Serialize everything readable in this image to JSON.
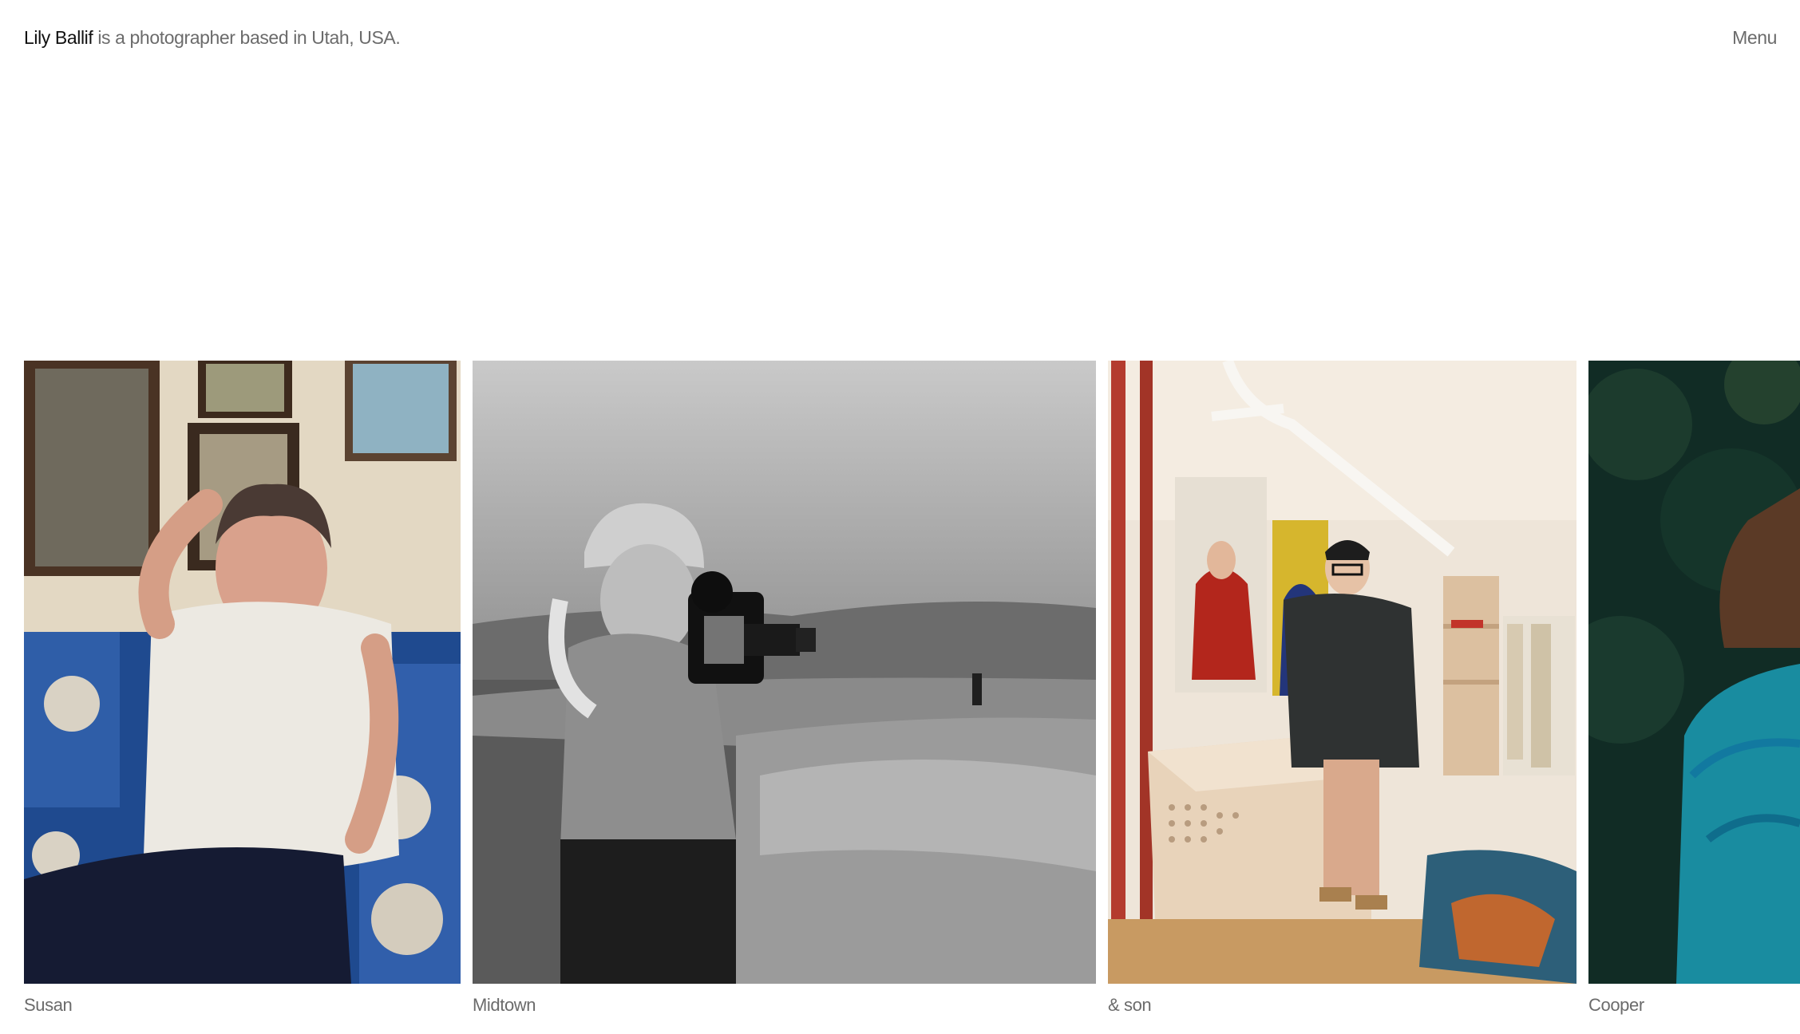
{
  "header": {
    "name": "Lily Ballif",
    "tagline": " is a photographer based in Utah, USA.",
    "menu_label": "Menu"
  },
  "gallery": {
    "projects": [
      {
        "title": "Susan"
      },
      {
        "title": "Midtown"
      },
      {
        "title": "& son"
      },
      {
        "title": "Cooper"
      }
    ]
  }
}
